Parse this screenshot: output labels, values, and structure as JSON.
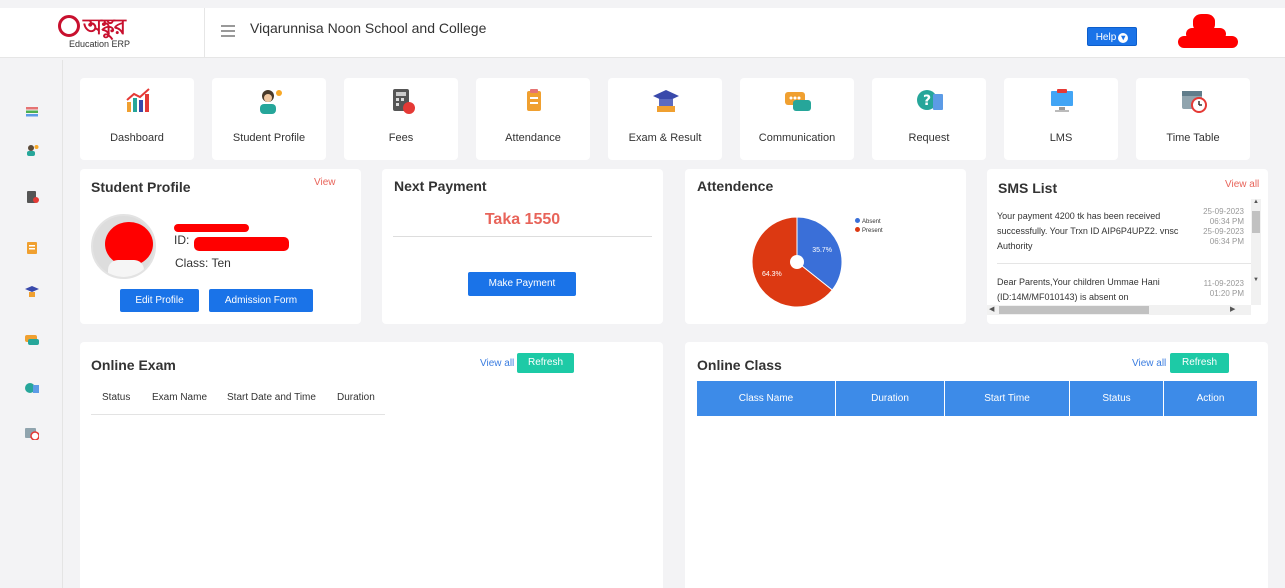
{
  "app": {
    "brand_text": "অঙ্কুর",
    "brand_sub": "Education ERP",
    "school_name": "Viqarunnisa Noon School and College",
    "help_label": "Help"
  },
  "sidebar": {
    "items": [
      {
        "icon": "dashboard-icon"
      },
      {
        "icon": "student-profile-icon"
      },
      {
        "icon": "fees-icon"
      },
      {
        "icon": "attendance-icon"
      },
      {
        "icon": "exam-result-icon"
      },
      {
        "icon": "communication-icon"
      },
      {
        "icon": "request-icon"
      },
      {
        "icon": "timetable-icon"
      }
    ]
  },
  "modules": [
    {
      "label": "Dashboard",
      "icon": "dashboard-chart-icon"
    },
    {
      "label": "Student Profile",
      "icon": "student-icon"
    },
    {
      "label": "Fees",
      "icon": "calculator-icon"
    },
    {
      "label": "Attendance",
      "icon": "clipboard-icon"
    },
    {
      "label": "Exam & Result",
      "icon": "graduation-icon"
    },
    {
      "label": "Communication",
      "icon": "chat-icon"
    },
    {
      "label": "Request",
      "icon": "question-icon"
    },
    {
      "label": "LMS",
      "icon": "monitor-icon"
    },
    {
      "label": "Time Table",
      "icon": "calendar-clock-icon"
    }
  ],
  "profile": {
    "title": "Student Profile",
    "view_link": "View",
    "id_label": "ID:",
    "class_label": "Class: Ten",
    "edit_btn": "Edit Profile",
    "admission_btn": "Admission Form"
  },
  "payment": {
    "title": "Next Payment",
    "amount": "Taka 1550",
    "btn": "Make Payment"
  },
  "attendance": {
    "title": "Attendence",
    "legend": [
      {
        "name": "Absent",
        "color": "#3a6fd8"
      },
      {
        "name": "Present",
        "color": "#dc3912"
      }
    ],
    "labels": {
      "absent": "35.7%",
      "present": "64.3%"
    }
  },
  "chart_data": {
    "type": "pie",
    "categories": [
      "Absent",
      "Present"
    ],
    "values": [
      35.7,
      64.3
    ],
    "title": "Attendence",
    "legend": "right",
    "donut": true
  },
  "sms": {
    "title": "SMS List",
    "view_all": "View all",
    "messages": [
      {
        "text": "Your payment 4200 tk has been received successfully. Your Trxn ID AIP6P4UPZ2. vnsc Authority",
        "date1": "25-09-2023",
        "time1": "06:34 PM",
        "date2": "25-09-2023",
        "time2": "06:34 PM"
      },
      {
        "text": "Dear Parents,Your children Ummae Hani (ID:14M/MF010143) is absent on",
        "date1": "11-09-2023",
        "time1": "01:20 PM"
      }
    ]
  },
  "exam": {
    "title": "Online Exam",
    "view_all": "View all",
    "refresh": "Refresh",
    "columns": [
      "Status",
      "Exam Name",
      "Start Date and Time",
      "Duration"
    ]
  },
  "class": {
    "title": "Online Class",
    "view_all": "View all",
    "refresh": "Refresh",
    "columns": [
      "Class Name",
      "Duration",
      "Start Time",
      "Status",
      "Action"
    ]
  }
}
